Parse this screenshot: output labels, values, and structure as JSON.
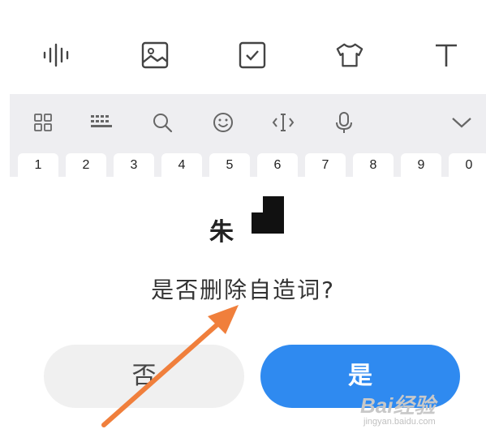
{
  "toolbar": {
    "icons": [
      "voice-wave-icon",
      "image-icon",
      "checkbox-icon",
      "tshirt-icon",
      "text-icon"
    ]
  },
  "keyboard": {
    "toolbar_icons": [
      "grid-icon",
      "keyboard-icon",
      "search-icon",
      "emoji-icon",
      "cursor-icon",
      "microphone-icon",
      "chevron-down-icon"
    ],
    "number_keys": [
      "1",
      "2",
      "3",
      "4",
      "5",
      "6",
      "7",
      "8",
      "9",
      "0"
    ]
  },
  "dialog": {
    "title": "朱",
    "message": "是否删除自造词?",
    "no_label": "否",
    "yes_label": "是"
  },
  "colors": {
    "primary": "#2f8af0",
    "arrow": "#f07f3c",
    "keyboard_bg": "#eeeef1"
  },
  "watermark": {
    "text": "Bai经验",
    "sub": "jingyan.baidu.com"
  }
}
